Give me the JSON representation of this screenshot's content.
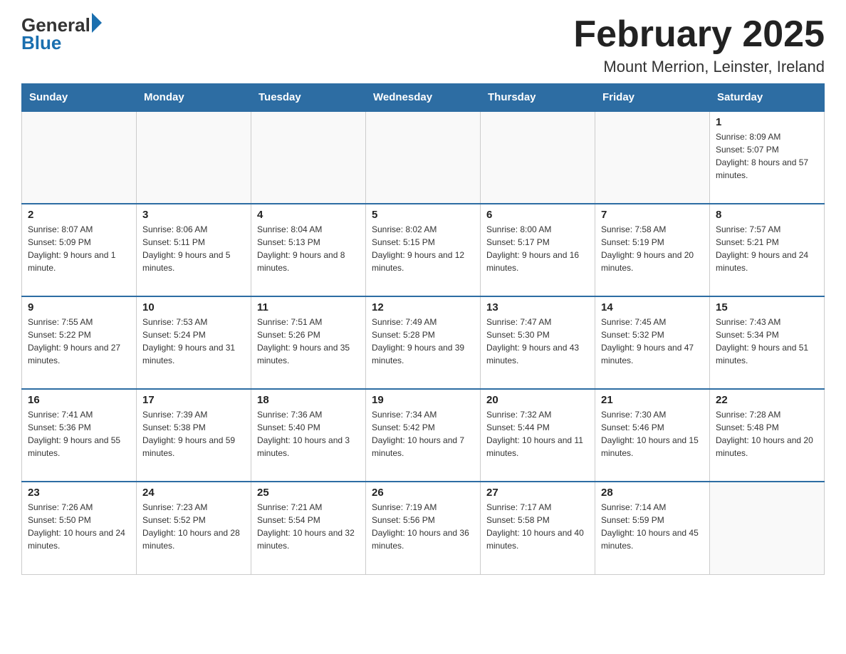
{
  "header": {
    "logo_general": "General",
    "logo_blue": "Blue",
    "month_title": "February 2025",
    "location": "Mount Merrion, Leinster, Ireland"
  },
  "days_of_week": [
    "Sunday",
    "Monday",
    "Tuesday",
    "Wednesday",
    "Thursday",
    "Friday",
    "Saturday"
  ],
  "weeks": [
    [
      {
        "day": "",
        "info": ""
      },
      {
        "day": "",
        "info": ""
      },
      {
        "day": "",
        "info": ""
      },
      {
        "day": "",
        "info": ""
      },
      {
        "day": "",
        "info": ""
      },
      {
        "day": "",
        "info": ""
      },
      {
        "day": "1",
        "info": "Sunrise: 8:09 AM\nSunset: 5:07 PM\nDaylight: 8 hours and 57 minutes."
      }
    ],
    [
      {
        "day": "2",
        "info": "Sunrise: 8:07 AM\nSunset: 5:09 PM\nDaylight: 9 hours and 1 minute."
      },
      {
        "day": "3",
        "info": "Sunrise: 8:06 AM\nSunset: 5:11 PM\nDaylight: 9 hours and 5 minutes."
      },
      {
        "day": "4",
        "info": "Sunrise: 8:04 AM\nSunset: 5:13 PM\nDaylight: 9 hours and 8 minutes."
      },
      {
        "day": "5",
        "info": "Sunrise: 8:02 AM\nSunset: 5:15 PM\nDaylight: 9 hours and 12 minutes."
      },
      {
        "day": "6",
        "info": "Sunrise: 8:00 AM\nSunset: 5:17 PM\nDaylight: 9 hours and 16 minutes."
      },
      {
        "day": "7",
        "info": "Sunrise: 7:58 AM\nSunset: 5:19 PM\nDaylight: 9 hours and 20 minutes."
      },
      {
        "day": "8",
        "info": "Sunrise: 7:57 AM\nSunset: 5:21 PM\nDaylight: 9 hours and 24 minutes."
      }
    ],
    [
      {
        "day": "9",
        "info": "Sunrise: 7:55 AM\nSunset: 5:22 PM\nDaylight: 9 hours and 27 minutes."
      },
      {
        "day": "10",
        "info": "Sunrise: 7:53 AM\nSunset: 5:24 PM\nDaylight: 9 hours and 31 minutes."
      },
      {
        "day": "11",
        "info": "Sunrise: 7:51 AM\nSunset: 5:26 PM\nDaylight: 9 hours and 35 minutes."
      },
      {
        "day": "12",
        "info": "Sunrise: 7:49 AM\nSunset: 5:28 PM\nDaylight: 9 hours and 39 minutes."
      },
      {
        "day": "13",
        "info": "Sunrise: 7:47 AM\nSunset: 5:30 PM\nDaylight: 9 hours and 43 minutes."
      },
      {
        "day": "14",
        "info": "Sunrise: 7:45 AM\nSunset: 5:32 PM\nDaylight: 9 hours and 47 minutes."
      },
      {
        "day": "15",
        "info": "Sunrise: 7:43 AM\nSunset: 5:34 PM\nDaylight: 9 hours and 51 minutes."
      }
    ],
    [
      {
        "day": "16",
        "info": "Sunrise: 7:41 AM\nSunset: 5:36 PM\nDaylight: 9 hours and 55 minutes."
      },
      {
        "day": "17",
        "info": "Sunrise: 7:39 AM\nSunset: 5:38 PM\nDaylight: 9 hours and 59 minutes."
      },
      {
        "day": "18",
        "info": "Sunrise: 7:36 AM\nSunset: 5:40 PM\nDaylight: 10 hours and 3 minutes."
      },
      {
        "day": "19",
        "info": "Sunrise: 7:34 AM\nSunset: 5:42 PM\nDaylight: 10 hours and 7 minutes."
      },
      {
        "day": "20",
        "info": "Sunrise: 7:32 AM\nSunset: 5:44 PM\nDaylight: 10 hours and 11 minutes."
      },
      {
        "day": "21",
        "info": "Sunrise: 7:30 AM\nSunset: 5:46 PM\nDaylight: 10 hours and 15 minutes."
      },
      {
        "day": "22",
        "info": "Sunrise: 7:28 AM\nSunset: 5:48 PM\nDaylight: 10 hours and 20 minutes."
      }
    ],
    [
      {
        "day": "23",
        "info": "Sunrise: 7:26 AM\nSunset: 5:50 PM\nDaylight: 10 hours and 24 minutes."
      },
      {
        "day": "24",
        "info": "Sunrise: 7:23 AM\nSunset: 5:52 PM\nDaylight: 10 hours and 28 minutes."
      },
      {
        "day": "25",
        "info": "Sunrise: 7:21 AM\nSunset: 5:54 PM\nDaylight: 10 hours and 32 minutes."
      },
      {
        "day": "26",
        "info": "Sunrise: 7:19 AM\nSunset: 5:56 PM\nDaylight: 10 hours and 36 minutes."
      },
      {
        "day": "27",
        "info": "Sunrise: 7:17 AM\nSunset: 5:58 PM\nDaylight: 10 hours and 40 minutes."
      },
      {
        "day": "28",
        "info": "Sunrise: 7:14 AM\nSunset: 5:59 PM\nDaylight: 10 hours and 45 minutes."
      },
      {
        "day": "",
        "info": ""
      }
    ]
  ]
}
